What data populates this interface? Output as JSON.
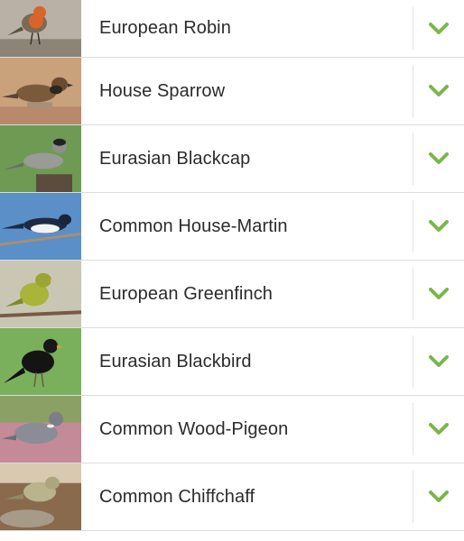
{
  "accent_color": "#7ab648",
  "birds": [
    {
      "name": "European Robin",
      "expand_icon": "chevron-down-icon"
    },
    {
      "name": "House Sparrow",
      "expand_icon": "chevron-down-icon"
    },
    {
      "name": "Eurasian Blackcap",
      "expand_icon": "chevron-down-icon"
    },
    {
      "name": "Common House-Martin",
      "expand_icon": "chevron-down-icon"
    },
    {
      "name": "European Greenfinch",
      "expand_icon": "chevron-down-icon"
    },
    {
      "name": "Eurasian Blackbird",
      "expand_icon": "chevron-down-icon"
    },
    {
      "name": "Common Wood-Pigeon",
      "expand_icon": "chevron-down-icon"
    },
    {
      "name": "Common Chiffchaff",
      "expand_icon": "chevron-down-icon"
    }
  ]
}
